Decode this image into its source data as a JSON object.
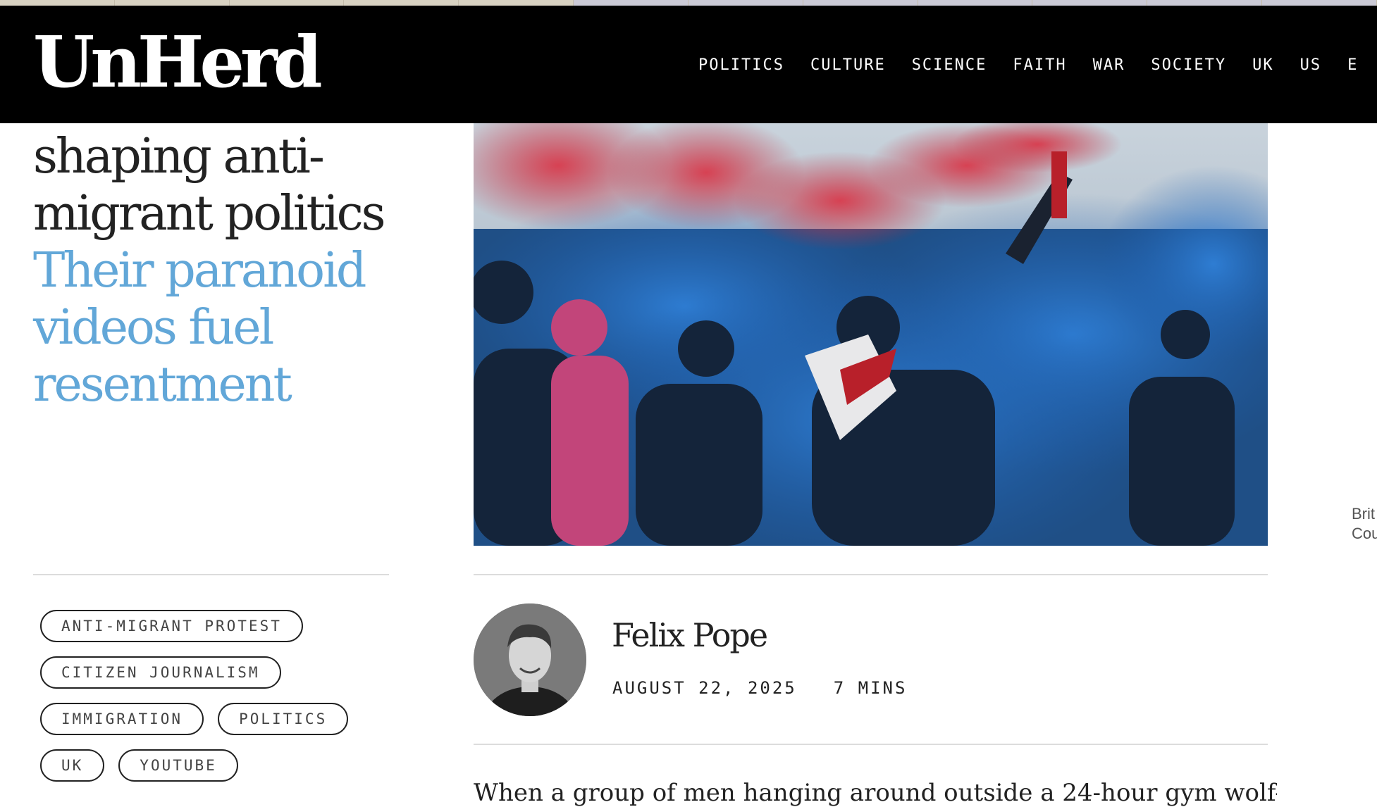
{
  "site": {
    "logo": "UnHerd",
    "nav": [
      "POLITICS",
      "CULTURE",
      "SCIENCE",
      "FAITH",
      "WAR",
      "SOCIETY",
      "UK",
      "US",
      "E"
    ]
  },
  "article": {
    "headline_lines": [
      "shaping anti-",
      "migrant politics"
    ],
    "standfirst_lines": [
      "Their paranoid",
      "videos fuel",
      "resentment"
    ],
    "image_caption_lines": [
      "Brit",
      "Cou"
    ],
    "tags": [
      "ANTI-MIGRANT PROTEST",
      "CITIZEN JOURNALISM",
      "IMMIGRATION",
      "POLITICS",
      "UK",
      "YOUTUBE"
    ],
    "author": "Felix Pope",
    "date": "AUGUST 22, 2025",
    "read_time": "7 MINS",
    "lede": "When a group of men hanging around outside a 24-hour gym wolf-"
  },
  "colors": {
    "accent_blue": "#62a7d8",
    "header_bg": "#000000",
    "text": "#222222"
  }
}
